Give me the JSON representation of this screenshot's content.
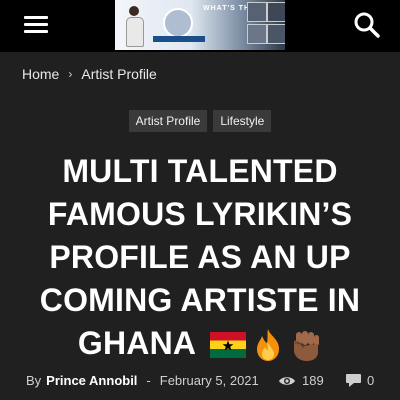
{
  "header": {
    "menu_icon": "hamburger-menu-icon",
    "logo_text": "WHAT'S THE NG",
    "search_icon": "search-icon",
    "background": "#000000"
  },
  "breadcrumb": {
    "home": "Home",
    "separator": "›",
    "current": "Artist Profile"
  },
  "tags": [
    "Artist Profile",
    "Lifestyle"
  ],
  "article": {
    "title": "MULTI TALENTED FAMOUS LYRIKIN’S PROFILE AS AN UP COMING ARTISTE IN GHANA",
    "title_emojis": [
      "ghana-flag-icon",
      "fire-icon",
      "raised-fist-icon"
    ]
  },
  "meta": {
    "by_label": "By",
    "author": "Prince Annobil",
    "dash": "-",
    "date": "February 5, 2021",
    "views_icon": "eye-icon",
    "views": "189",
    "comments_icon": "comment-icon",
    "comments": "0"
  },
  "colors": {
    "page_background": "#202020",
    "topbar": "#000000",
    "tag_background": "#3a3a3a",
    "text": "#ffffff",
    "muted_text": "#cfcfcf",
    "ghana_red": "#ce1126",
    "ghana_gold": "#fcd116",
    "ghana_green": "#006b3f",
    "ghana_star": "#000000"
  }
}
